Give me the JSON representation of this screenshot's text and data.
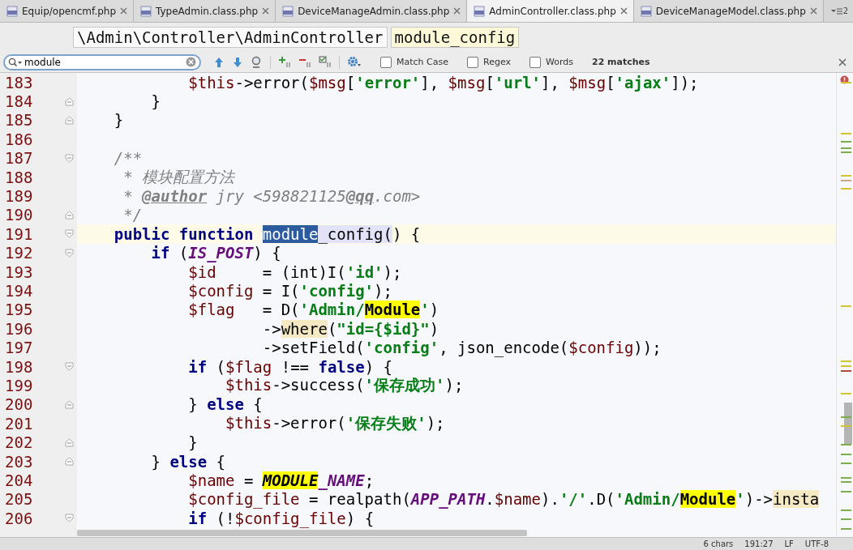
{
  "tabs": [
    {
      "label": "Equip/opencmf.php",
      "selected": false
    },
    {
      "label": "TypeAdmin.class.php",
      "selected": false
    },
    {
      "label": "DeviceManageAdmin.class.php",
      "selected": false
    },
    {
      "label": "AdminController.class.php",
      "selected": true
    },
    {
      "label": "DeviceManageModel.class.php",
      "selected": false
    }
  ],
  "hidden_tabs_count": "2",
  "breadcrumbs": [
    {
      "label": "\\Admin\\Controller\\AdminController",
      "selected": false
    },
    {
      "label": "module_config",
      "selected": true
    }
  ],
  "search": {
    "value": "module",
    "options": [
      {
        "label": "Match Case",
        "checked": false
      },
      {
        "label": "Regex",
        "checked": false
      },
      {
        "label": "Words",
        "checked": false
      }
    ],
    "matches": "22 matches"
  },
  "code_lines": [
    {
      "number": "183",
      "current": false,
      "kind": "plain",
      "tokens": [
        {
          "text": "            $this",
          "kind": "var"
        },
        {
          "text": "->error(",
          "kind": "plain"
        },
        {
          "text": "$msg",
          "kind": "var"
        },
        {
          "text": "[",
          "kind": "plain"
        },
        {
          "text": "'error'",
          "kind": "str"
        },
        {
          "text": "], ",
          "kind": "plain"
        },
        {
          "text": "$msg",
          "kind": "var"
        },
        {
          "text": "[",
          "kind": "plain"
        },
        {
          "text": "'url'",
          "kind": "str"
        },
        {
          "text": "], ",
          "kind": "plain"
        },
        {
          "text": "$msg",
          "kind": "var"
        },
        {
          "text": "[",
          "kind": "plain"
        },
        {
          "text": "'ajax'",
          "kind": "str"
        },
        {
          "text": "]);",
          "kind": "plain"
        }
      ]
    },
    {
      "number": "184",
      "current": false,
      "kind": "fold_end",
      "tokens": [
        {
          "text": "        }",
          "kind": "plain"
        }
      ]
    },
    {
      "number": "185",
      "current": false,
      "kind": "fold_end",
      "tokens": [
        {
          "text": "    }",
          "kind": "plain"
        }
      ]
    },
    {
      "number": "186",
      "current": false,
      "kind": "plain"
    },
    {
      "number": "187",
      "current": false,
      "kind": "fold_start",
      "tokens": [
        {
          "text": "    /**",
          "kind": "cmt"
        }
      ]
    },
    {
      "number": "188",
      "current": false,
      "kind": "plain",
      "tokens": [
        {
          "text": "     * 模块配置方法",
          "kind": "cmt"
        }
      ]
    },
    {
      "number": "189",
      "current": false,
      "kind": "plain",
      "tokens": [
        {
          "text": "     * ",
          "kind": "cmt"
        },
        {
          "text": "@author",
          "kind": "tag"
        },
        {
          "text": " jry <598821125",
          "kind": "cmt"
        },
        {
          "text": "@qq",
          "kind": "tag"
        },
        {
          "text": ".com>",
          "kind": "cmt"
        }
      ]
    },
    {
      "number": "190",
      "current": false,
      "kind": "fold_end",
      "tokens": [
        {
          "text": "     */",
          "kind": "cmt"
        }
      ]
    },
    {
      "number": "191",
      "current": true,
      "kind": "fold_start",
      "tokens": [
        {
          "text": "    public function ",
          "kind": "kw"
        },
        {
          "text": "module",
          "kind": "plain_current"
        },
        {
          "text": "_config(",
          "kind": "plain_ident"
        },
        {
          "text": ") {",
          "kind": "plain"
        }
      ]
    },
    {
      "number": "192",
      "current": false,
      "kind": "fold_start",
      "tokens": [
        {
          "text": "        if",
          "kind": "kw"
        },
        {
          "text": " (",
          "kind": "plain"
        },
        {
          "text": "IS_POST",
          "kind": "const"
        },
        {
          "text": ") {",
          "kind": "plain"
        }
      ]
    },
    {
      "number": "193",
      "current": false,
      "kind": "plain",
      "tokens": [
        {
          "text": "            $id",
          "kind": "var"
        },
        {
          "text": "     = (int)I(",
          "kind": "plain"
        },
        {
          "text": "'id'",
          "kind": "str"
        },
        {
          "text": ");",
          "kind": "plain"
        }
      ]
    },
    {
      "number": "194",
      "current": false,
      "kind": "plain",
      "tokens": [
        {
          "text": "            $config",
          "kind": "var"
        },
        {
          "text": " = I(",
          "kind": "plain"
        },
        {
          "text": "'config'",
          "kind": "str"
        },
        {
          "text": ");",
          "kind": "plain"
        }
      ]
    },
    {
      "number": "195",
      "current": false,
      "kind": "plain",
      "tokens": [
        {
          "text": "            $flag",
          "kind": "var"
        },
        {
          "text": "   = D(",
          "kind": "plain"
        },
        {
          "text": "'Admin/",
          "kind": "str"
        },
        {
          "text": "Module",
          "kind": "str_match"
        },
        {
          "text": "'",
          "kind": "str"
        },
        {
          "text": ")",
          "kind": "plain"
        }
      ]
    },
    {
      "number": "196",
      "current": false,
      "kind": "plain",
      "tokens": [
        {
          "text": "                    ->",
          "kind": "plain"
        },
        {
          "text": "where",
          "kind": "plain_usage"
        },
        {
          "text": "(",
          "kind": "plain"
        },
        {
          "text": "\"id={$id}\"",
          "kind": "str"
        },
        {
          "text": ")",
          "kind": "plain"
        }
      ]
    },
    {
      "number": "197",
      "current": false,
      "kind": "plain",
      "tokens": [
        {
          "text": "                    ->setField(",
          "kind": "plain"
        },
        {
          "text": "'config'",
          "kind": "str"
        },
        {
          "text": ", json_encode(",
          "kind": "plain"
        },
        {
          "text": "$config",
          "kind": "var"
        },
        {
          "text": "));",
          "kind": "plain"
        }
      ]
    },
    {
      "number": "198",
      "current": false,
      "kind": "fold_start",
      "tokens": [
        {
          "text": "            if",
          "kind": "kw"
        },
        {
          "text": " (",
          "kind": "plain"
        },
        {
          "text": "$flag",
          "kind": "var"
        },
        {
          "text": " !== ",
          "kind": "plain"
        },
        {
          "text": "false",
          "kind": "kw"
        },
        {
          "text": ") {",
          "kind": "plain"
        }
      ]
    },
    {
      "number": "199",
      "current": false,
      "kind": "plain",
      "tokens": [
        {
          "text": "                $this",
          "kind": "var"
        },
        {
          "text": "->success(",
          "kind": "plain"
        },
        {
          "text": "'保存成功'",
          "kind": "str"
        },
        {
          "text": ");",
          "kind": "plain"
        }
      ]
    },
    {
      "number": "200",
      "current": false,
      "kind": "fold_end",
      "tokens": [
        {
          "text": "            } ",
          "kind": "plain"
        },
        {
          "text": "else",
          "kind": "kw"
        },
        {
          "text": " {",
          "kind": "plain"
        }
      ]
    },
    {
      "number": "201",
      "current": false,
      "kind": "plain",
      "tokens": [
        {
          "text": "                $this",
          "kind": "var"
        },
        {
          "text": "->error(",
          "kind": "plain"
        },
        {
          "text": "'保存失败'",
          "kind": "str"
        },
        {
          "text": ");",
          "kind": "plain"
        }
      ]
    },
    {
      "number": "202",
      "current": false,
      "kind": "fold_end",
      "tokens": [
        {
          "text": "            }",
          "kind": "plain"
        }
      ]
    },
    {
      "number": "203",
      "current": false,
      "kind": "fold_end",
      "tokens": [
        {
          "text": "        } ",
          "kind": "plain"
        },
        {
          "text": "else",
          "kind": "kw"
        },
        {
          "text": " {",
          "kind": "plain"
        }
      ]
    },
    {
      "number": "204",
      "current": false,
      "kind": "plain",
      "tokens": [
        {
          "text": "            $name",
          "kind": "var"
        },
        {
          "text": " = ",
          "kind": "plain"
        },
        {
          "text": "MODULE",
          "kind": "const_match"
        },
        {
          "text": "_NAME",
          "kind": "const"
        },
        {
          "text": ";",
          "kind": "plain"
        }
      ]
    },
    {
      "number": "205",
      "current": false,
      "kind": "plain",
      "tokens": [
        {
          "text": "            $config_file",
          "kind": "var"
        },
        {
          "text": " = realpath(",
          "kind": "plain"
        },
        {
          "text": "APP_PATH",
          "kind": "const"
        },
        {
          "text": ".",
          "kind": "plain"
        },
        {
          "text": "$name",
          "kind": "var"
        },
        {
          "text": ").",
          "kind": "plain"
        },
        {
          "text": "'/'",
          "kind": "str"
        },
        {
          "text": ".D(",
          "kind": "plain"
        },
        {
          "text": "'Admin/",
          "kind": "str"
        },
        {
          "text": "Module",
          "kind": "str_match"
        },
        {
          "text": "'",
          "kind": "str"
        },
        {
          "text": ")->",
          "kind": "plain"
        },
        {
          "text": "insta",
          "kind": "plain_usage"
        }
      ]
    },
    {
      "number": "206",
      "current": false,
      "kind": "fold_start",
      "tokens": [
        {
          "text": "            if",
          "kind": "kw"
        },
        {
          "text": " (!",
          "kind": "plain"
        },
        {
          "text": "$config_file",
          "kind": "var"
        },
        {
          "text": ") {",
          "kind": "plain"
        }
      ]
    }
  ],
  "status_bar": {
    "selection": "6 chars",
    "position": "191:27",
    "line_separator": "LF",
    "encoding": "UTF-8"
  }
}
